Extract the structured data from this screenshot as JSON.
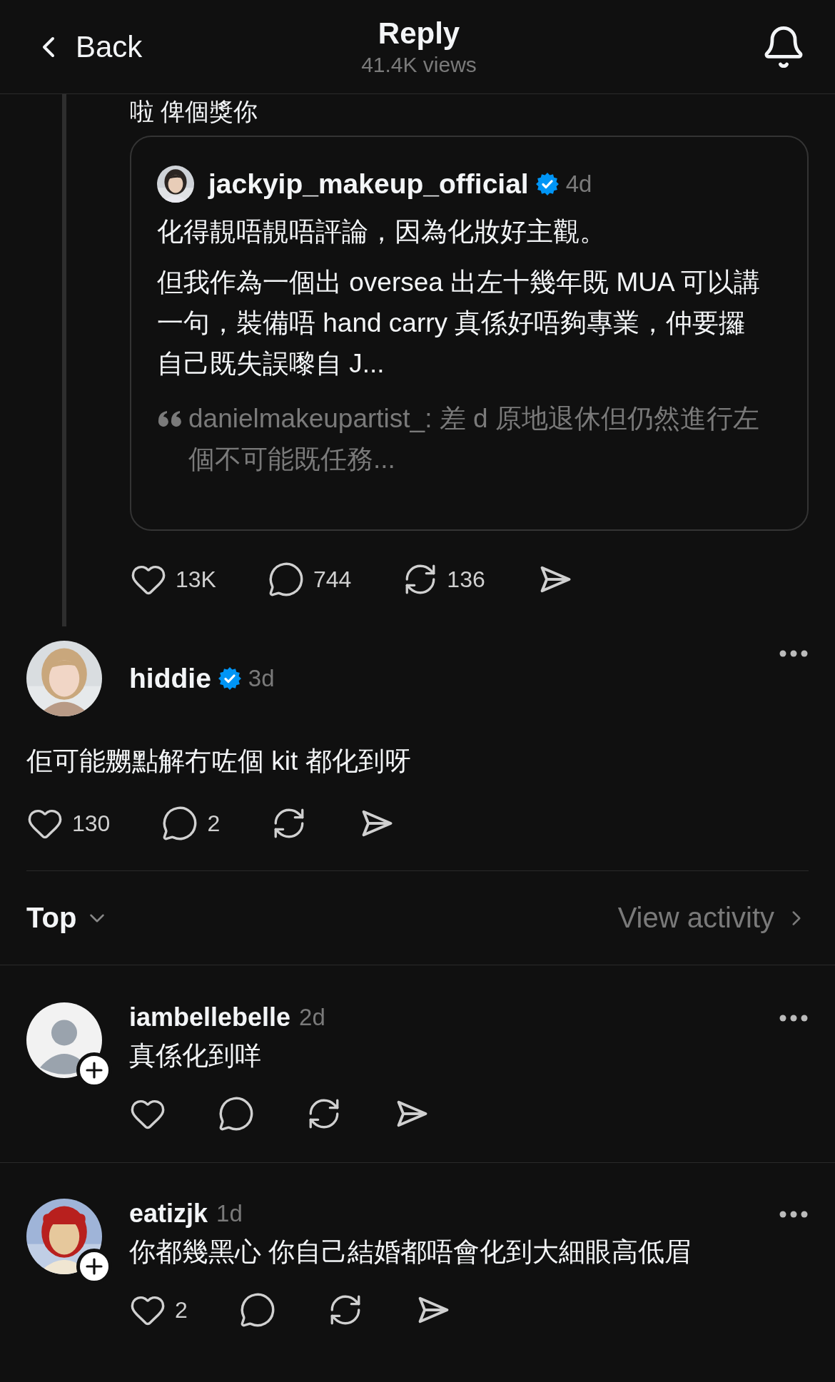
{
  "header": {
    "back": "Back",
    "title": "Reply",
    "views": "41.4K views"
  },
  "parent_snippet": "啦 俾個獎你",
  "quoted_post": {
    "username": "jackyip_makeup_official",
    "verified": true,
    "time": "4d",
    "paragraphs": [
      "化得靚唔靚唔評論，因為化妝好主觀。",
      "但我作為一個出 oversea 出左十幾年既 MUA 可以講一句，裝備唔 hand carry 真係好唔夠專業，仲要攞自己既失誤嚟自 J..."
    ],
    "quote": "danielmakeupartist_: 差 d 原地退休但仍然進行左個不可能既任務..."
  },
  "parent_actions": {
    "likes": "13K",
    "replies": "744",
    "reposts": "136"
  },
  "post": {
    "username": "hiddie",
    "verified": true,
    "time": "3d",
    "text": "佢可能嬲點解冇咗個 kit 都化到呀",
    "actions": {
      "likes": "130",
      "replies": "2"
    }
  },
  "sort": {
    "label": "Top",
    "link": "View activity"
  },
  "comments": [
    {
      "username": "iambellebelle",
      "time": "2d",
      "avatar": {
        "kind": "default"
      },
      "can_follow": true,
      "text": "真係化到咩"
    },
    {
      "username": "eatizjk",
      "time": "1d",
      "can_follow": true,
      "text": "你都幾黑心 你自己結婚都唔會化到大細眼高低眉",
      "actions": {
        "likes": "2"
      }
    }
  ]
}
